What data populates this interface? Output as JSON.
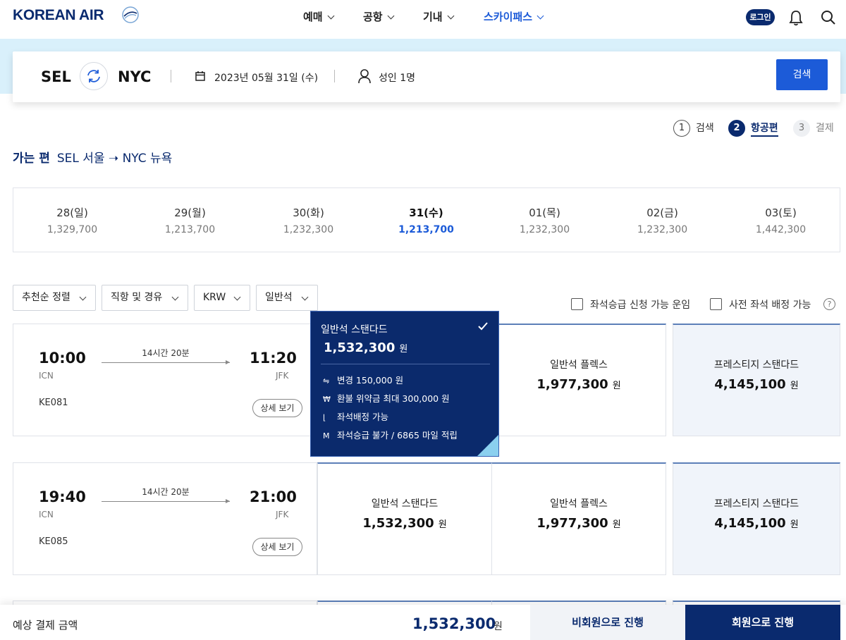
{
  "header": {
    "logo": "KOREAN AIR",
    "nav": [
      {
        "label": "예매"
      },
      {
        "label": "공항"
      },
      {
        "label": "기내"
      },
      {
        "label": "스카이패스"
      }
    ],
    "login_label": "로그인",
    "icons": [
      "bell-icon",
      "search-icon"
    ]
  },
  "search": {
    "origin": "SEL",
    "destination": "NYC",
    "date": "2023년 05월 31일 (수)",
    "passengers": "성인 1명",
    "button_label": "검색"
  },
  "steps": [
    {
      "num": "1",
      "label": "검색"
    },
    {
      "num": "2",
      "label": "항공편"
    },
    {
      "num": "3",
      "label": "결제"
    }
  ],
  "route": {
    "direction_label": "가는 편",
    "text": "SEL  서울 ➝ NYC  뉴욕"
  },
  "dates": [
    {
      "day": "28(일)",
      "price": "1,329,700"
    },
    {
      "day": "29(월)",
      "price": "1,213,700"
    },
    {
      "day": "30(화)",
      "price": "1,232,300"
    },
    {
      "day": "31(수)",
      "price": "1,213,700"
    },
    {
      "day": "01(목)",
      "price": "1,232,300"
    },
    {
      "day": "02(금)",
      "price": "1,232,300"
    },
    {
      "day": "03(토)",
      "price": "1,442,300"
    }
  ],
  "filters": {
    "sort": "추천순 정렬",
    "stops": "직항 및 경유",
    "currency": "KRW",
    "cabin": "일반석",
    "upgrade_check": "좌석승급 신청 가능 운임",
    "seat_check": "사전 좌석 배정 가능",
    "help": "?"
  },
  "flights": [
    {
      "dep_time": "10:00",
      "arr_time": "11:20",
      "dep_airport": "ICN",
      "arr_airport": "JFK",
      "duration": "14시간 20분",
      "flight_no": "KE081",
      "detail_label": "상세 보기",
      "fares": [
        {
          "name": "일반석 플렉스",
          "price": "1,977,300"
        },
        {
          "name": "프레스티지 스탠다드",
          "price": "4,145,100"
        }
      ]
    },
    {
      "dep_time": "19:40",
      "arr_time": "21:00",
      "dep_airport": "ICN",
      "arr_airport": "JFK",
      "duration": "14시간 20분",
      "flight_no": "KE085",
      "detail_label": "상세 보기",
      "fares": [
        {
          "name": "일반석 스탠다드",
          "price": "1,532,300"
        },
        {
          "name": "일반석 플렉스",
          "price": "1,977,300"
        },
        {
          "name": "프레스티지 스탠다드",
          "price": "4,145,100"
        }
      ]
    }
  ],
  "currency_unit": "원",
  "popup": {
    "name": "일반석 스탠다드",
    "price": "1,532,300",
    "items": [
      {
        "icon": "change-icon",
        "text": "변경 150,000 원"
      },
      {
        "icon": "won-icon",
        "text": "환불 위약금 최대 300,000 원"
      },
      {
        "icon": "seat-icon",
        "text": "좌석배정 가능"
      },
      {
        "icon": "mileage-icon",
        "text": "좌석승급 불가 / 6865 마일 적립"
      }
    ]
  },
  "bottom": {
    "label": "예상 결제 금액",
    "price": "1,532,300",
    "guest_button": "비회원으로 진행",
    "member_button": "회원으로 진행"
  },
  "colors": {
    "navy": "#0a2a6e",
    "accent": "#1c5bd8",
    "band": "#d9f0fb"
  }
}
